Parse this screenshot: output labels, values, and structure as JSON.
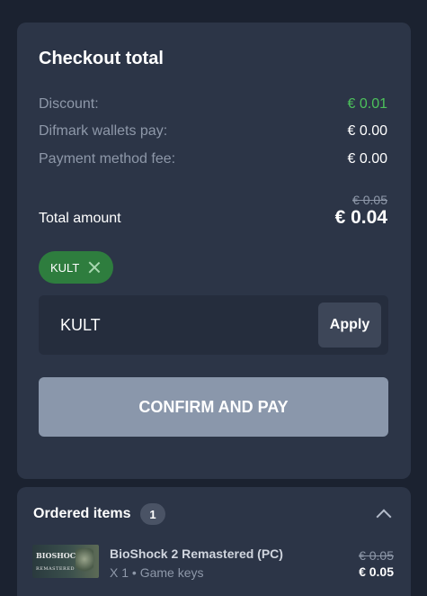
{
  "checkout": {
    "title": "Checkout total",
    "rows": [
      {
        "label": "Discount:",
        "value": "€ 0.01",
        "color": "#4cc15b"
      },
      {
        "label": "Difmark wallets pay:",
        "value": "€ 0.00"
      },
      {
        "label": "Payment method fee:",
        "value": "€ 0.00"
      }
    ],
    "old_total": "€ 0.05",
    "total_label": "Total amount",
    "total_value": "€ 0.04",
    "applied_coupon": "KULT",
    "promo_input_value": "KULT",
    "apply_label": "Apply",
    "confirm_label": "CONFIRM AND PAY"
  },
  "orders": {
    "title": "Ordered items",
    "count": "1",
    "items": [
      {
        "thumbnail_text": "BIOSHOCK",
        "thumbnail_subtext": "REMASTERED",
        "name": "BioShock 2 Remastered (PC)",
        "meta": "X 1 • Game keys",
        "old_price": "€ 0.05",
        "price": "€ 0.05"
      }
    ]
  },
  "colors": {
    "background": "#1b2230",
    "card": "#2c3547",
    "accent_green": "#4cc15b",
    "confirm_button": "#8a97ab"
  },
  "icons": {
    "remove_coupon": "close-icon",
    "collapse": "chevron-up-icon"
  }
}
